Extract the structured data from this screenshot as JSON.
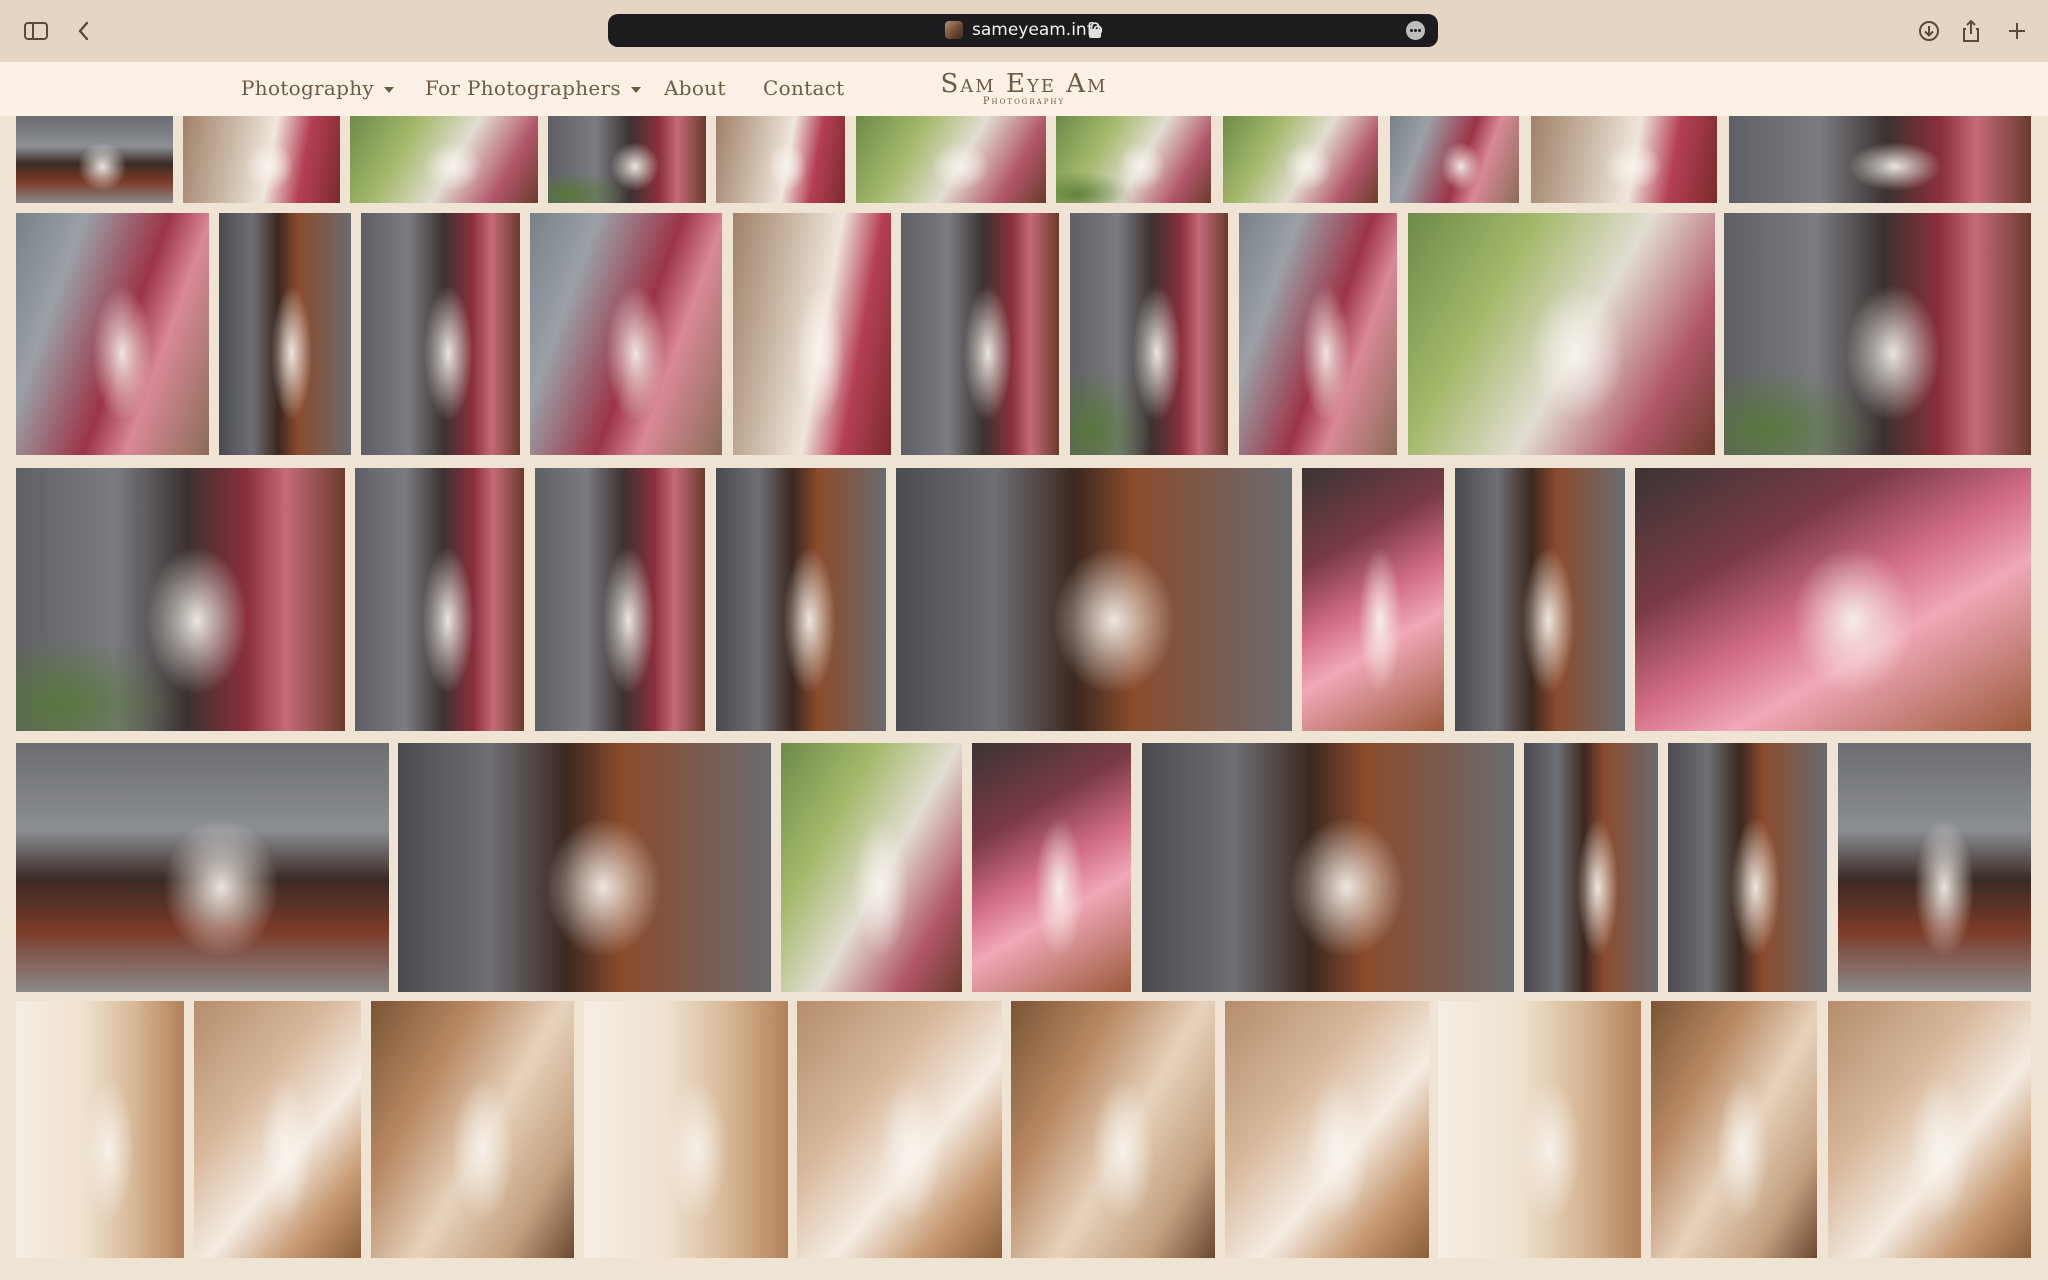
{
  "browser": {
    "url": "sameyeam.info",
    "icons": [
      "sidebar-toggle-icon",
      "back-arrow-icon",
      "lock-icon",
      "more-icon",
      "download-icon",
      "share-icon",
      "plus-icon"
    ]
  },
  "nav": {
    "items": [
      {
        "label": "Photography",
        "has_dropdown": true
      },
      {
        "label": "For Photographers",
        "has_dropdown": true
      },
      {
        "label": "About",
        "has_dropdown": false
      },
      {
        "label": "Contact",
        "has_dropdown": false
      }
    ],
    "logo_title": "Sam Eye Am",
    "logo_subtitle": "Photography"
  },
  "gallery": {
    "rows": [
      {
        "tiles": [
          "g3",
          "g5",
          "g4",
          "g1",
          "g5",
          "g4",
          "g4",
          "g4",
          "g2",
          "g5",
          "g1"
        ]
      },
      {
        "tiles": [
          "g2",
          "g6",
          "g1",
          "g2",
          "g5",
          "g1",
          "g1",
          "g2",
          "g4",
          "g1"
        ]
      },
      {
        "tiles": [
          "g1",
          "g1",
          "g1",
          "g6",
          "g6",
          "g9",
          "g6",
          "g9"
        ]
      },
      {
        "tiles": [
          "g3",
          "g6",
          "g4",
          "g9",
          "g6",
          "g6",
          "g6",
          "g3"
        ]
      },
      {
        "tiles": [
          "g8",
          "g7",
          "g10",
          "g8",
          "g7",
          "g10",
          "g7",
          "g8",
          "g10",
          "g7"
        ]
      }
    ]
  }
}
